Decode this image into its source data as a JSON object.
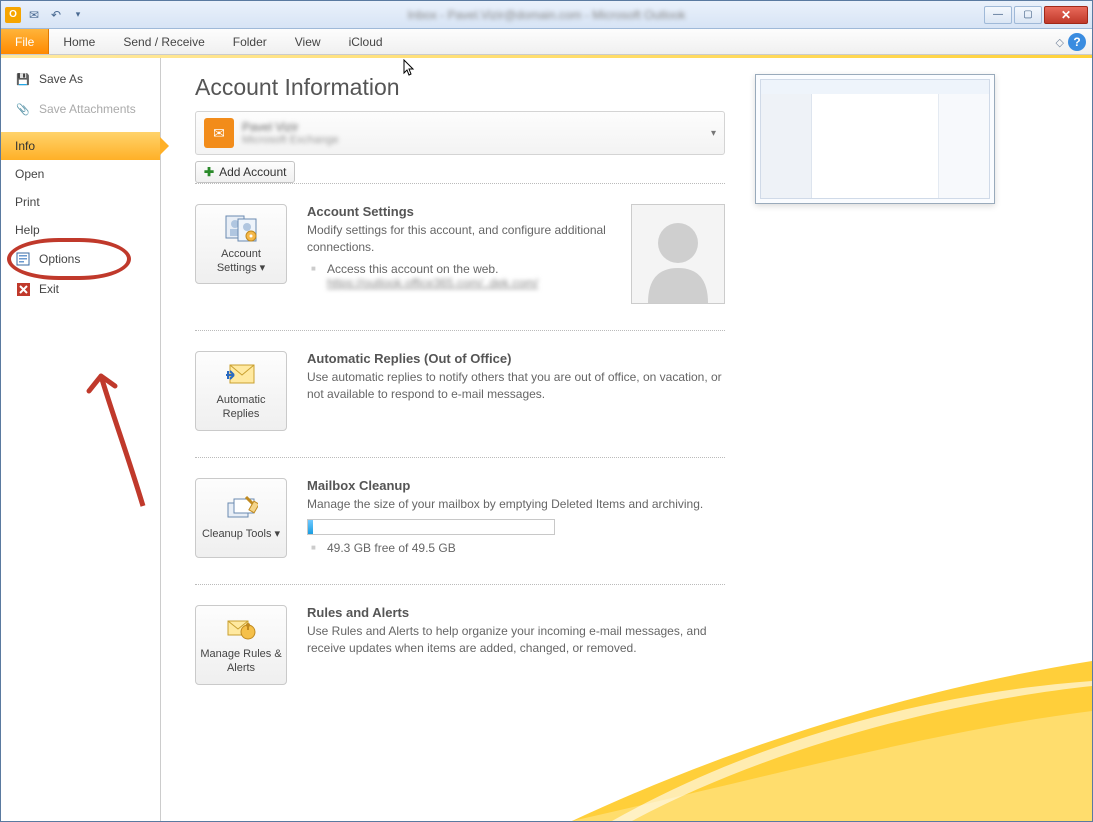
{
  "window": {
    "title_blur": "Inbox - Pavel.Vizir@domain.com - Microsoft Outlook"
  },
  "ribbon": {
    "file": "File",
    "tabs": [
      "Home",
      "Send / Receive",
      "Folder",
      "View",
      "iCloud"
    ]
  },
  "sidebar": {
    "save_as": "Save As",
    "save_attachments": "Save Attachments",
    "info": "Info",
    "open": "Open",
    "print": "Print",
    "help": "Help",
    "options": "Options",
    "exit": "Exit"
  },
  "main": {
    "title": "Account Information",
    "account": {
      "name": "Pavel Vizir",
      "sub": "Microsoft Exchange"
    },
    "add_account": "Add Account",
    "sections": {
      "settings": {
        "btn": "Account Settings",
        "btn_drop": "▾",
        "h": "Account Settings",
        "p": "Modify settings for this account, and configure additional connections.",
        "line1": "Access this account on the web.",
        "link": "https://outlook.office365.com/..dek.com/"
      },
      "auto": {
        "btn": "Automatic Replies",
        "h": "Automatic Replies (Out of Office)",
        "p": "Use automatic replies to notify others that you are out of office, on vacation, or not available to respond to e-mail messages."
      },
      "cleanup": {
        "btn": "Cleanup Tools",
        "btn_drop": "▾",
        "h": "Mailbox Cleanup",
        "p": "Manage the size of your mailbox by emptying Deleted Items and archiving.",
        "free": "49.3 GB free of 49.5 GB"
      },
      "rules": {
        "btn": "Manage Rules & Alerts",
        "h": "Rules and Alerts",
        "p": "Use Rules and Alerts to help organize your incoming e-mail messages, and receive updates when items are added, changed, or removed."
      }
    }
  }
}
